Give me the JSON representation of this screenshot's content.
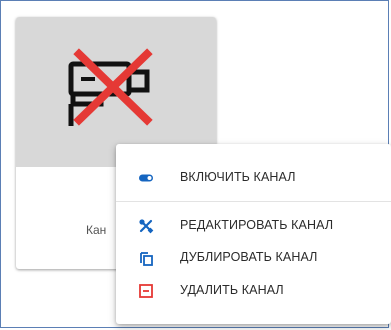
{
  "card": {
    "label": "Кан",
    "thumbnail_icon": "camera-disabled-icon"
  },
  "menu": {
    "items": [
      {
        "label": "ВКЛЮЧИТЬ КАНАЛ",
        "icon": "toggle-icon",
        "color": "#1565c0"
      },
      {
        "label": "РЕДАКТИРОВАТЬ КАНАЛ",
        "icon": "tools-icon",
        "color": "#1565c0"
      },
      {
        "label": "ДУБЛИРОВАТЬ КАНАЛ",
        "icon": "copy-icon",
        "color": "#1565c0"
      },
      {
        "label": "УДАЛИТЬ КАНАЛ",
        "icon": "delete-icon",
        "color": "#e53935"
      }
    ]
  },
  "colors": {
    "accent_blue": "#1565c0",
    "danger_red": "#e53935",
    "frame_border": "#5b7fb5"
  }
}
